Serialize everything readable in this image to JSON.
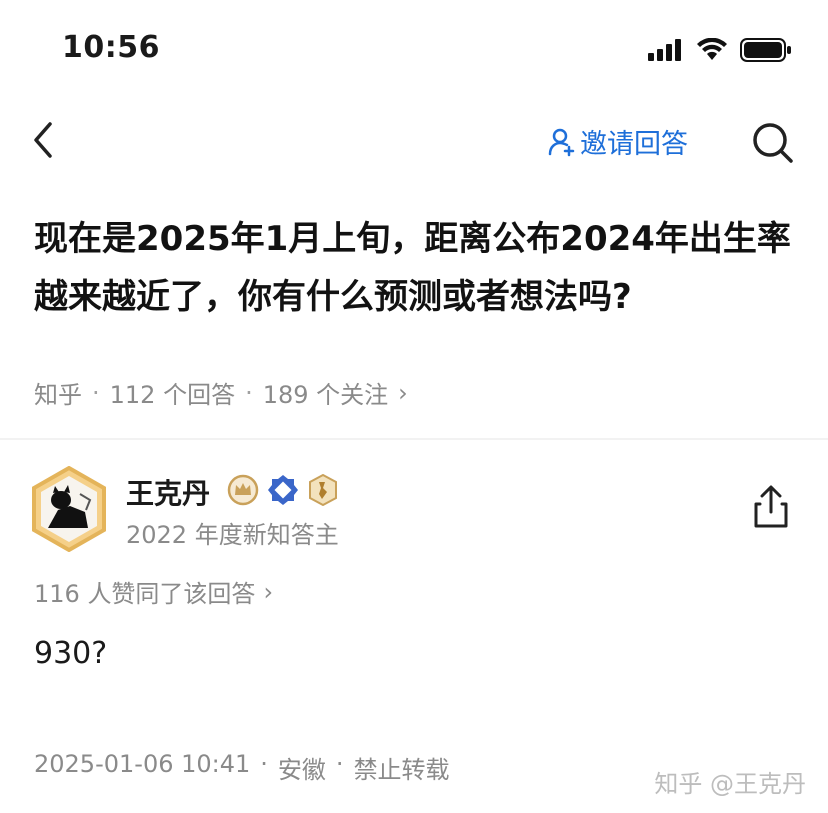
{
  "status_bar": {
    "time": "10:56"
  },
  "nav": {
    "invite_label": "邀请回答"
  },
  "question": {
    "title": "现在是2025年1月上旬，距离公布2024年出生率越来越近了，你有什么预测或者想法吗?",
    "source": "知乎",
    "answers_count": "112 个回答",
    "followers_count": "189 个关注",
    "chevron": "›"
  },
  "author": {
    "name": "王克丹",
    "subtitle": "2022 年度新知答主"
  },
  "answer": {
    "votes": "116 人赞同了该回答",
    "votes_chevron": "›",
    "body": "930?",
    "date": "2025-01-06 10:41",
    "location": "安徽",
    "copyright": "禁止转载",
    "separator": "·"
  },
  "watermark": "知乎 @王克丹",
  "colors": {
    "accent": "#1e6fd9",
    "muted": "#8a8a8a",
    "badge_gold": "#c9a15a",
    "badge_blue": "#3a66c9"
  }
}
